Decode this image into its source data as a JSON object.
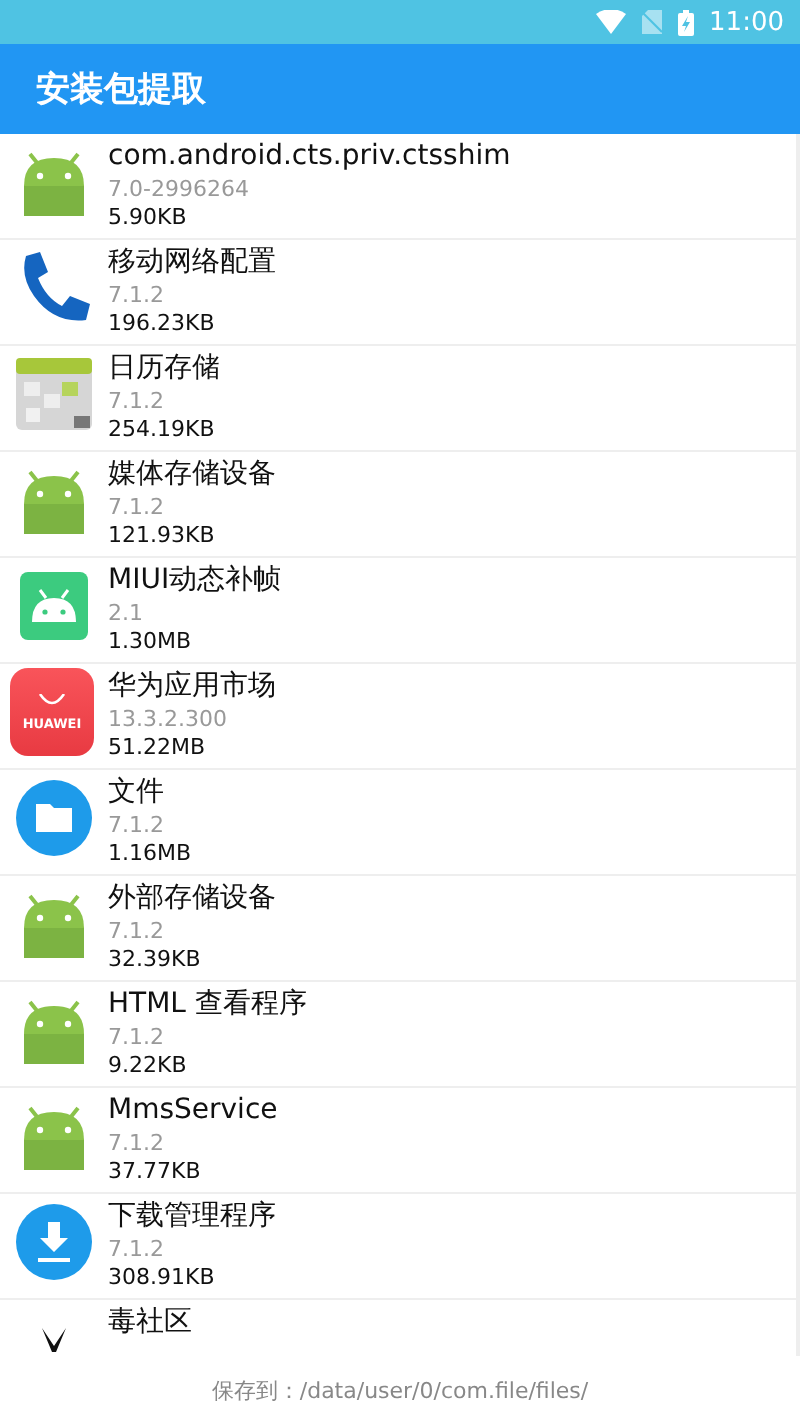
{
  "status_bar": {
    "time": "11:00"
  },
  "toolbar": {
    "title": "安装包提取"
  },
  "apps": [
    {
      "kind": "android",
      "name": "com.android.cts.priv.ctsshim",
      "version": "7.0-2996264",
      "size": "5.90KB"
    },
    {
      "kind": "phone",
      "name": "移动网络配置",
      "version": "7.1.2",
      "size": "196.23KB"
    },
    {
      "kind": "calendar",
      "name": "日历存储",
      "version": "7.1.2",
      "size": "254.19KB"
    },
    {
      "kind": "android",
      "name": "媒体存储设备",
      "version": "7.1.2",
      "size": "121.93KB"
    },
    {
      "kind": "miui",
      "name": "MIUI动态补帧",
      "version": "2.1",
      "size": "1.30MB"
    },
    {
      "kind": "huawei",
      "icon_text": "HUAWEI",
      "name": "华为应用市场",
      "version": "13.3.2.300",
      "size": "51.22MB"
    },
    {
      "kind": "folder",
      "name": "文件",
      "version": "7.1.2",
      "size": "1.16MB"
    },
    {
      "kind": "android",
      "name": "外部存储设备",
      "version": "7.1.2",
      "size": "32.39KB"
    },
    {
      "kind": "android",
      "name": "HTML 查看程序",
      "version": "7.1.2",
      "size": "9.22KB"
    },
    {
      "kind": "android",
      "name": "MmsService",
      "version": "7.1.2",
      "size": "37.77KB"
    },
    {
      "kind": "download",
      "name": "下载管理程序",
      "version": "7.1.2",
      "size": "308.91KB"
    },
    {
      "kind": "mark",
      "name": "毒社区"
    }
  ],
  "footer": {
    "label": "保存到：",
    "path": "/data/user/0/com.file/files/"
  }
}
